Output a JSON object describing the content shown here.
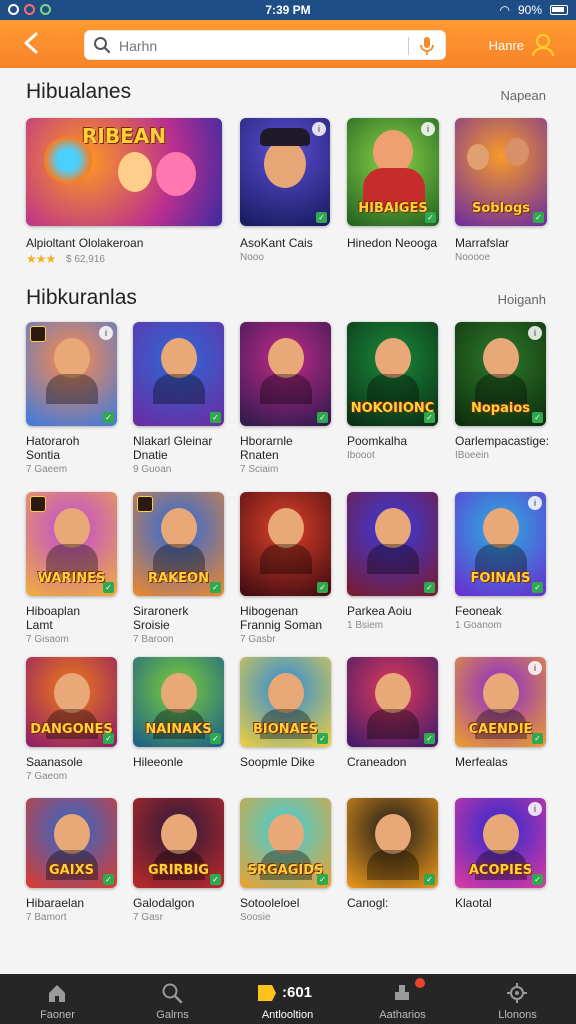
{
  "status_bar": {
    "time": "7:39 PM",
    "battery": "90%"
  },
  "header": {
    "search_placeholder": "Harhn",
    "user_label": "Hanre"
  },
  "sections": [
    {
      "title": "Hibualanes",
      "more": "Napean"
    },
    {
      "title": "Hibkuranlas",
      "more": "Hoiganh"
    }
  ],
  "featured": [
    {
      "name": "Alpioltant Ololakeroan",
      "sub": "$ 62,916",
      "rating": "★★★",
      "tile_text": "RIBEAN"
    },
    {
      "name": "AsoKant Cais",
      "sub": "Nooo",
      "tile_text": ""
    },
    {
      "name": "Hinedon Neooga",
      "sub": "",
      "tile_text": "HIBAIGES"
    },
    {
      "name": "Marrafslar",
      "sub": "Nooooe",
      "tile_text": "Soblogs"
    }
  ],
  "grid": [
    {
      "name": "Hatoraroh",
      "name2": "Sontia",
      "sub": "7 Gaeem"
    },
    {
      "name": "Nlakarl Gleinar",
      "name2": "Dnatie",
      "sub": "9 Guoan"
    },
    {
      "name": "Hborarnle",
      "name2": "Rnaten",
      "sub": "7 Sciaim"
    },
    {
      "name": "Poomkalha",
      "name2": "",
      "sub": "Ibooot"
    },
    {
      "name": "Oarlempacastige:",
      "name2": "",
      "sub": "IBoeein"
    },
    {
      "name": "Hiboaplan",
      "name2": "Lamt",
      "sub": "7 Gisaom"
    },
    {
      "name": "Siraronerk",
      "name2": "Sroisie",
      "sub": "7 Baroon"
    },
    {
      "name": "Hibogenan",
      "name2": "Frannig Soman",
      "sub": "7 Gasbr"
    },
    {
      "name": "Parkea Aoiu",
      "name2": "",
      "sub": "1 Bsiem"
    },
    {
      "name": "Feoneak",
      "name2": "",
      "sub": "1 Goanom"
    },
    {
      "name": "Saanasole",
      "name2": "",
      "sub": "7 Gaeom"
    },
    {
      "name": "Hileeonle",
      "name2": "",
      "sub": ""
    },
    {
      "name": "Soopmle Dike",
      "name2": "",
      "sub": ""
    },
    {
      "name": "Craneadon",
      "name2": "",
      "sub": ""
    },
    {
      "name": "Merfealas",
      "name2": "",
      "sub": ""
    },
    {
      "name": "Hibaraelan",
      "name2": "",
      "sub": "7 Bamort"
    },
    {
      "name": "Galodalgon",
      "name2": "",
      "sub": "7 Gasr"
    },
    {
      "name": "Sotooleloel",
      "name2": "",
      "sub": "Soosie"
    },
    {
      "name": "Canogl:",
      "name2": "",
      "sub": ""
    },
    {
      "name": "Klaotal",
      "name2": "",
      "sub": ""
    }
  ],
  "grid_tile_texts": [
    "",
    "",
    "",
    "NOKOIIONC",
    "Nopaios",
    "WARINES",
    "RAKEON",
    "",
    "",
    "FOINAIS",
    "DANGONES",
    "NAINAKS",
    "BIONAES",
    "",
    "CAENDIE",
    "GAIXS",
    "GRIRBIG",
    "SRGAGIDS",
    "",
    "ACOPIES"
  ],
  "nav": [
    {
      "label": "Faoner",
      "icon": "home-icon"
    },
    {
      "label": "Galrns",
      "icon": "search-icon"
    },
    {
      "label": "Antlooltion",
      "icon": "play-icon",
      "badge_text": ":601"
    },
    {
      "label": "Aatharios",
      "icon": "download-icon"
    },
    {
      "label": "Llonons",
      "icon": "settings-icon"
    }
  ]
}
